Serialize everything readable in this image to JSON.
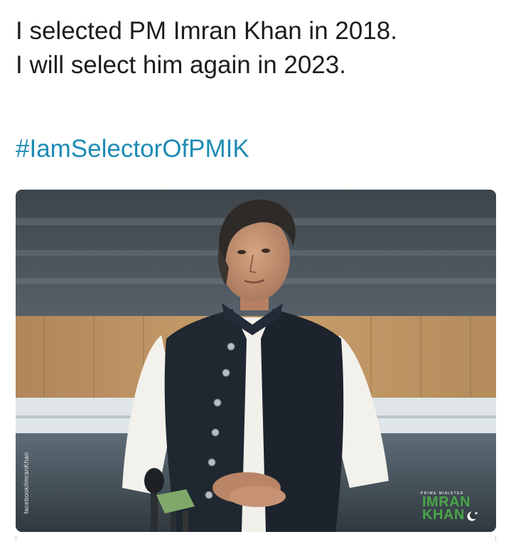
{
  "post": {
    "line1": "I selected PM Imran Khan in 2018.",
    "line2": "I will select him again in 2023.",
    "hashtag": "#IamSelectorOfPMIK"
  },
  "photo": {
    "side_watermark": "facebook/ImranKhan",
    "logo_prime_minister": "PRIME MINISTER",
    "logo_name_line1": "IMRAN",
    "logo_name_line2": "KHAN",
    "logo_icon": "crescent-star-icon"
  },
  "colors": {
    "text": "#1c1c1c",
    "hashtag": "#1e8bb6",
    "logo_green": "#49a548"
  }
}
